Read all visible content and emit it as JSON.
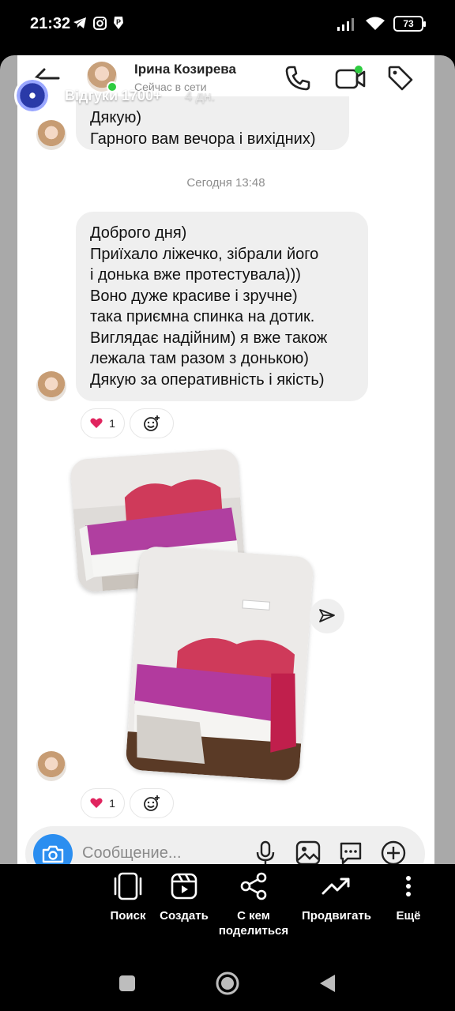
{
  "status_bar": {
    "time": "21:32",
    "battery": "73",
    "left_icons": [
      "telegram-icon",
      "instagram-icon",
      "pay-icon"
    ],
    "right_icons": [
      "signal-icon",
      "wifi-icon",
      "battery-icon"
    ]
  },
  "story": {
    "account_name": "Відгуки 1700+",
    "posted_ago": "4 дн."
  },
  "dm": {
    "contact_name": "Ірина Козирева",
    "contact_status": "Сейчас в сети",
    "messages": [
      {
        "text": "Дякую)\nГарного вам вечора і вихідних)"
      },
      {
        "text": "Доброго дня)\nПриїхало ліжечко, зібрали його\nі донька вже протестувала)))\nВоно дуже красиве і зручне)\nтака приємна спинка на дотик.\nВиглядає надійним) я вже також\nлежала там разом з донькою)\nДякую за оперативність і якість)"
      }
    ],
    "date_separator": "Сегодня 13:48",
    "reaction_count_1": "1",
    "reaction_count_2": "1",
    "composer_placeholder": "Сообщение..."
  },
  "actions": [
    {
      "label": "Поиск",
      "icon": "search-screen-icon"
    },
    {
      "label": "Создать",
      "icon": "create-icon"
    },
    {
      "label": "С кем\nподелиться",
      "icon": "share-icon"
    },
    {
      "label": "Продвигать",
      "icon": "promote-icon"
    },
    {
      "label": "Ещё",
      "icon": "more-icon"
    }
  ],
  "colors": {
    "accent_blue": "#2b8ef0",
    "online_green": "#2ecc40",
    "bubble_gray": "#efefef",
    "heart_red": "#e0245e"
  }
}
